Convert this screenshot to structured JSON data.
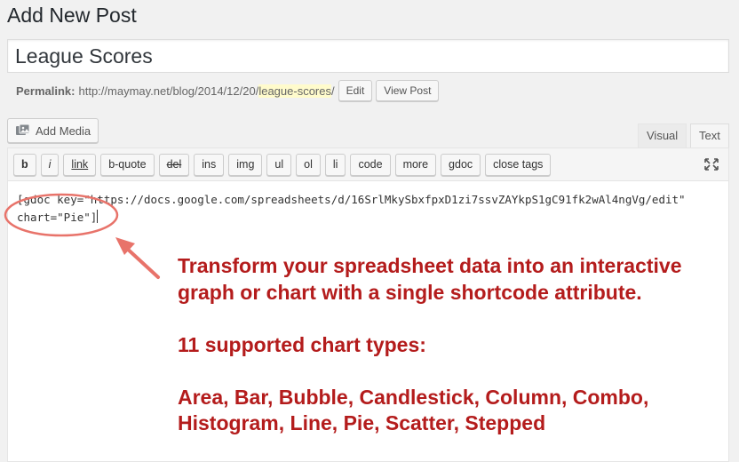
{
  "page": {
    "title": "Add New Post"
  },
  "post": {
    "title_value": "League Scores"
  },
  "permalink": {
    "label": "Permalink:",
    "base": "http://maymay.net/blog/2014/12/20/",
    "slug": "league-scores",
    "suffix": "/",
    "edit_label": "Edit",
    "view_label": "View Post"
  },
  "media": {
    "add_media_label": "Add Media"
  },
  "tabs": {
    "visual": "Visual",
    "text": "Text"
  },
  "toolbar": {
    "buttons": [
      "b",
      "i",
      "link",
      "b-quote",
      "del",
      "ins",
      "img",
      "ul",
      "ol",
      "li",
      "code",
      "more",
      "gdoc",
      "close tags"
    ]
  },
  "editor": {
    "line1": "[gdoc key=\"https://docs.google.com/spreadsheets/d/16SrlMkySbxfpxD1zi7ssvZAYkpS1gC91fk2wAl4ngVg/edit\"",
    "line2": "chart=\"Pie\"]"
  },
  "annotation": {
    "line1": "Transform your spreadsheet data into an interactive",
    "line2": "graph or chart with a single shortcode attribute.",
    "line3": "11 supported chart types:",
    "line4": "Area, Bar, Bubble, Candlestick, Column, Combo,",
    "line5": "Histogram, Line, Pie, Scatter, Stepped",
    "color": "#b41c1c",
    "ellipse_color": "#e8736a"
  }
}
